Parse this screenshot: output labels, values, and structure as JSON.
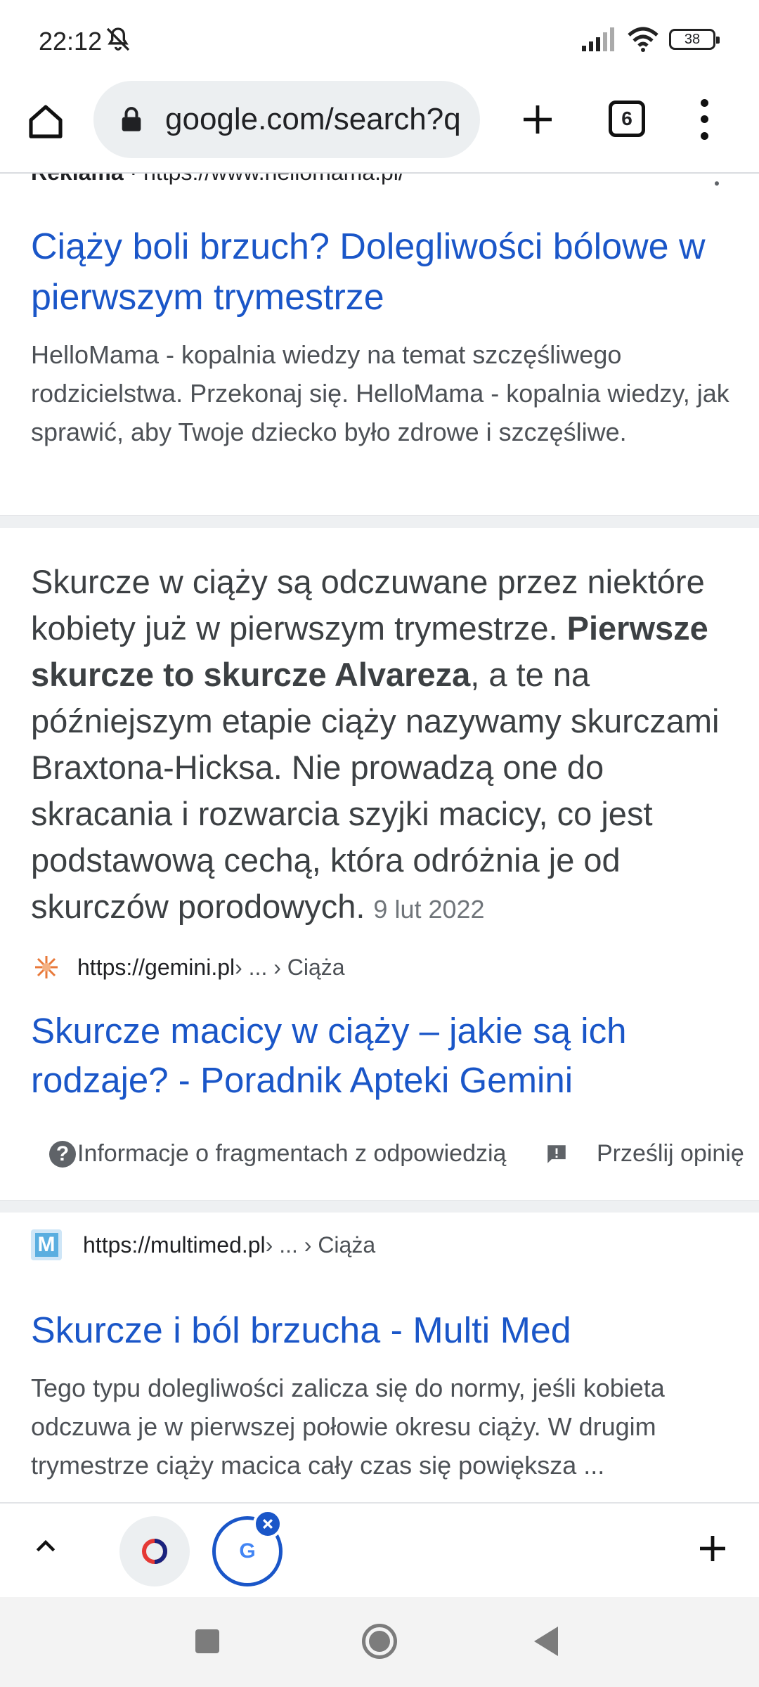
{
  "status_bar": {
    "time": "22:12",
    "battery": "38"
  },
  "toolbar": {
    "url": "google.com/search?q",
    "tab_count": "6"
  },
  "ad": {
    "label": "Reklama",
    "url": "https://www.hellomama.pl/",
    "title": "Ciąży boli brzuch? Dolegliwości bólowe w pierwszym trymestrze",
    "snippet": "HelloMama - kopalnia wiedzy na temat szczęśliwego rodzicielstwa. Przekonaj się. HelloMama - kopalnia wiedzy, jak sprawić, aby Twoje dziecko było zdrowe i szczęśliwe."
  },
  "featured": {
    "text_before": "Skurcze w ciąży są odczuwane przez niektóre kobiety już w pierwszym trymestrze. ",
    "text_bold": "Pierwsze skurcze to skurcze Alvareza",
    "text_after": ", a te na późniejszym etapie ciąży nazywamy skurczami Braxtona-Hicksa. Nie prowadzą one do skracania i rozwarcia szyjki macicy, co jest podstawową cechą, która odróżnia je od skurczów porodowych.",
    "date": "9 lut 2022",
    "source_url": "https://gemini.pl",
    "source_crumb": " › ... › Ciąża",
    "title": "Skurcze macicy w ciąży – jakie są ich rodzaje? - Poradnik Apteki Gemini",
    "about_label": "Informacje o fragmentach z odpowiedzią",
    "feedback_label": "Prześlij opinię"
  },
  "result2": {
    "source_url": "https://multimed.pl",
    "source_crumb": " › ... › Ciąża",
    "favicon_letter": "M",
    "title": "Skurcze i ból brzucha - Multi Med",
    "snippet": "Tego typu dolegliwości zalicza się do normy, jeśli kobieta odczuwa je w pierwszej połowie okresu ciąży. W drugim trymestrze ciąży macica cały czas się powiększa ..."
  },
  "tabstrip": {
    "active_tab_letter": "G"
  },
  "colors": {
    "link": "#1a56c8",
    "snippet": "#4d5156",
    "divider": "#eef0f2"
  }
}
